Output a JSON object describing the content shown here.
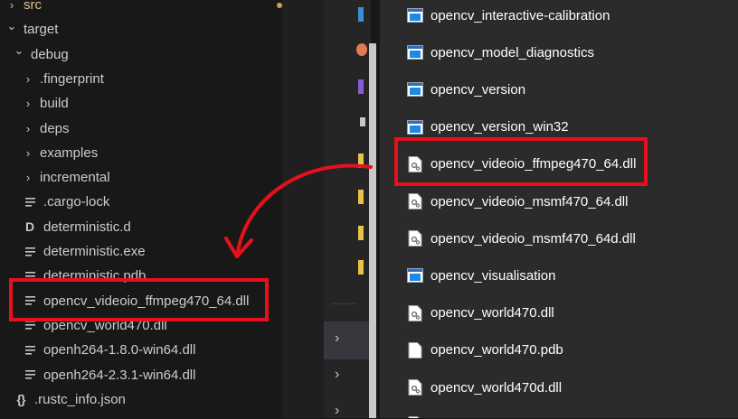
{
  "explorer": {
    "items": [
      {
        "label": "src",
        "kind": "folder-collapsed",
        "depth": 0,
        "modified": true
      },
      {
        "label": "target",
        "kind": "folder-expanded",
        "depth": 0
      },
      {
        "label": "debug",
        "kind": "folder-expanded",
        "depth": 1
      },
      {
        "label": ".fingerprint",
        "kind": "folder-collapsed",
        "depth": 2
      },
      {
        "label": "build",
        "kind": "folder-collapsed",
        "depth": 2
      },
      {
        "label": "deps",
        "kind": "folder-collapsed",
        "depth": 2
      },
      {
        "label": "examples",
        "kind": "folder-collapsed",
        "depth": 2
      },
      {
        "label": "incremental",
        "kind": "folder-collapsed",
        "depth": 2
      },
      {
        "label": ".cargo-lock",
        "kind": "file",
        "depth": 2
      },
      {
        "label": "deterministic.d",
        "kind": "d-file",
        "depth": 2
      },
      {
        "label": "deterministic.exe",
        "kind": "file",
        "depth": 2
      },
      {
        "label": "deterministic.pdb",
        "kind": "file",
        "depth": 2
      },
      {
        "label": "opencv_videoio_ffmpeg470_64.dll",
        "kind": "file",
        "depth": 2,
        "highlighted": true
      },
      {
        "label": "opencv_world470.dll",
        "kind": "file",
        "depth": 2
      },
      {
        "label": "openh264-1.8.0-win64.dll",
        "kind": "file",
        "depth": 2
      },
      {
        "label": "openh264-2.3.1-win64.dll",
        "kind": "file",
        "depth": 2
      },
      {
        "label": ".rustc_info.json",
        "kind": "json-file",
        "depth": 1
      }
    ]
  },
  "file_pane": {
    "items": [
      {
        "label": "opencv_interactive-calibration",
        "icon": "app-window-icon"
      },
      {
        "label": "opencv_model_diagnostics",
        "icon": "app-window-icon"
      },
      {
        "label": "opencv_version",
        "icon": "app-window-icon"
      },
      {
        "label": "opencv_version_win32",
        "icon": "app-window-icon"
      },
      {
        "label": "opencv_videoio_ffmpeg470_64.dll",
        "icon": "dll-gear-icon",
        "highlighted": true
      },
      {
        "label": "opencv_videoio_msmf470_64.dll",
        "icon": "dll-gear-icon"
      },
      {
        "label": "opencv_videoio_msmf470_64d.dll",
        "icon": "dll-gear-icon"
      },
      {
        "label": "opencv_visualisation",
        "icon": "app-window-icon"
      },
      {
        "label": "opencv_world470.dll",
        "icon": "dll-gear-icon"
      },
      {
        "label": "opencv_world470.pdb",
        "icon": "blank-file-icon"
      },
      {
        "label": "opencv_world470d.dll",
        "icon": "dll-gear-icon"
      }
    ]
  },
  "colors": {
    "highlight_box": "#e8101c",
    "arrow": "#e8101c",
    "explorer_bg": "#181818",
    "pane_bg": "#2b2b2b"
  }
}
